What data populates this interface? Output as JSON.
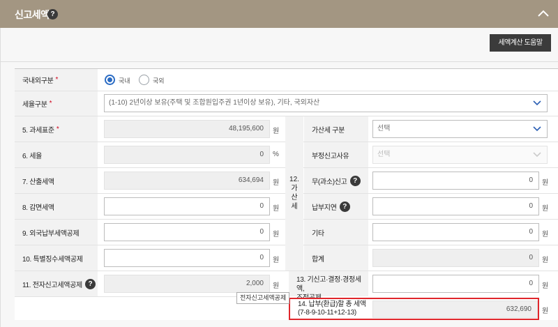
{
  "header": {
    "title": "신고세액",
    "help_glyph": "?"
  },
  "toolbar": {
    "calc_help_label": "세액계산 도움말"
  },
  "form": {
    "domestic": {
      "label": "국내외구분",
      "required": "*",
      "options": [
        "국내",
        "국외"
      ],
      "selected": "국내"
    },
    "tax_rate_type": {
      "label": "세율구분",
      "required": "*",
      "value": "(1-10) 2년이상 보유(주택 및 조합원입주권 1년이상 보유), 기타, 국외자산"
    },
    "left_rows": [
      {
        "label": "5. 과세표준",
        "required": "*",
        "value": "48,195,600",
        "unit": "원",
        "editable": false
      },
      {
        "label": "6. 세율",
        "required": "",
        "value": "0",
        "unit": "%",
        "editable": false
      },
      {
        "label": "7. 산출세액",
        "required": "",
        "value": "634,694",
        "unit": "원",
        "editable": false
      },
      {
        "label": "8. 감면세액",
        "required": "",
        "value": "0",
        "unit": "원",
        "editable": true
      },
      {
        "label": "9. 외국납부세액공제",
        "required": "",
        "value": "0",
        "unit": "원",
        "editable": true
      },
      {
        "label": "10. 특별징수세액공제",
        "required": "",
        "value": "0",
        "unit": "원",
        "editable": true
      },
      {
        "label": "11. 전자신고세액공제",
        "required": "",
        "value": "2,000",
        "unit": "원",
        "editable": false,
        "help_glyph": "?"
      }
    ],
    "penalty_group_label": [
      "12.",
      "가",
      "산",
      "세"
    ],
    "penalty_rows": {
      "type": {
        "label": "가산세 구분",
        "placeholder": "선택"
      },
      "reason": {
        "label": "부정신고사유",
        "placeholder": "선택"
      },
      "no_report": {
        "label": "무(과소)신고",
        "value": "0",
        "unit": "원",
        "help_glyph": "?"
      },
      "late_payment": {
        "label": "납부지연",
        "value": "0",
        "unit": "원",
        "help_glyph": "?"
      },
      "other": {
        "label": "기타",
        "value": "0",
        "unit": "원"
      },
      "total": {
        "label": "합계",
        "value": "0",
        "unit": "원"
      }
    },
    "row13": {
      "label_line1": "13. 기신고·결정·경정세액,",
      "label_line2": "조정공제",
      "value": "0",
      "unit": "원"
    },
    "row14": {
      "label_line1": "14. 납부(환급)할 총 세액",
      "label_line2": "(7-8-9-10-11+12-13)",
      "value": "632,690",
      "unit": "원"
    },
    "tooltip": "전자신고세액공제"
  },
  "colors": {
    "header_bg": "#a39682",
    "highlight": "#e0262b",
    "radio_active": "#2b6cc4"
  }
}
